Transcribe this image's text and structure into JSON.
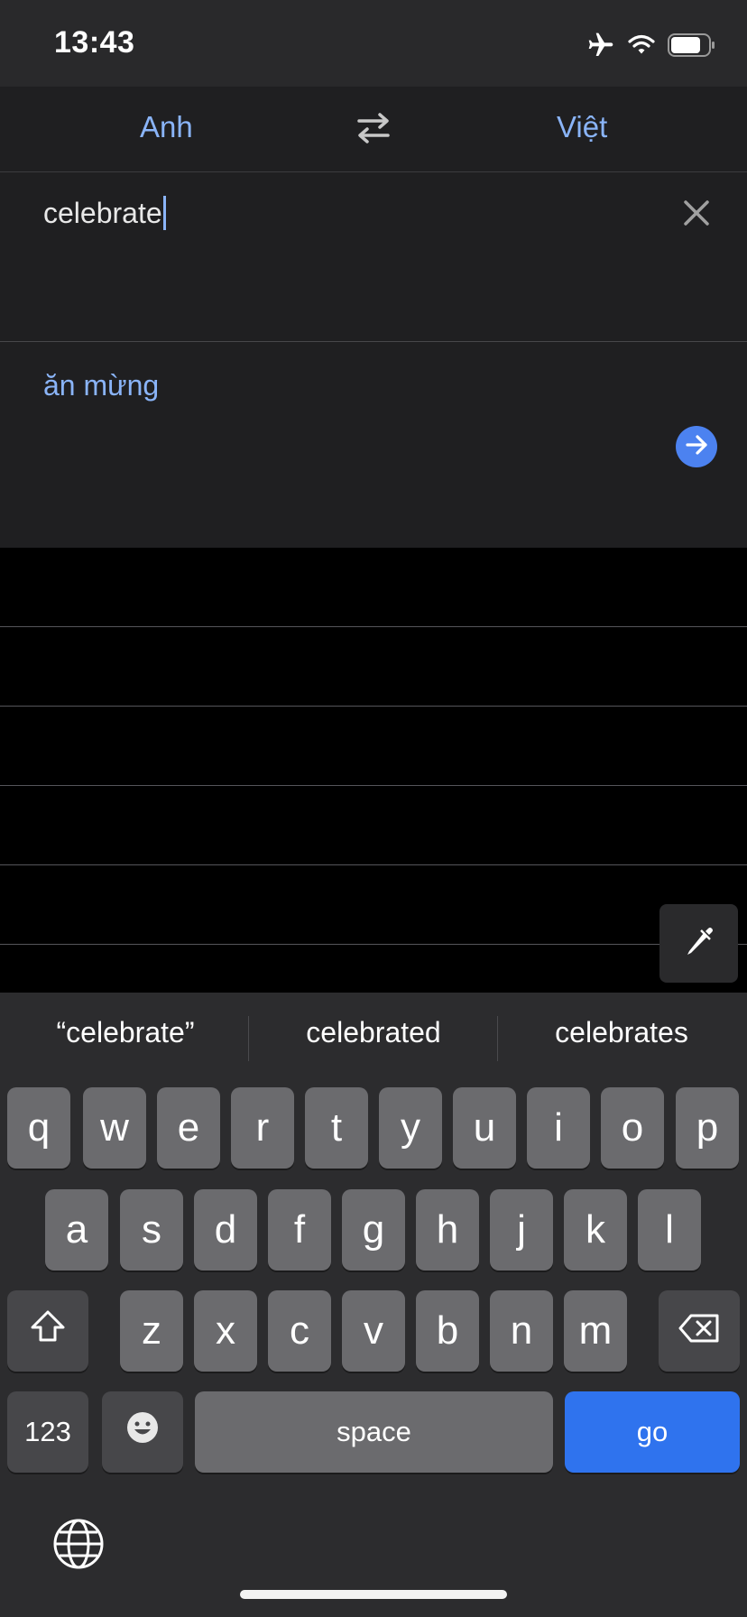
{
  "status_bar": {
    "time": "13:43",
    "icons": [
      "airplane-icon",
      "wifi-icon",
      "battery-icon"
    ]
  },
  "languages": {
    "source": "Anh",
    "target": "Việt",
    "swap_icon": "swap-arrows-icon"
  },
  "input": {
    "text": "celebrate",
    "clear_icon": "close-icon"
  },
  "result": {
    "text": "ăn mừng",
    "action_icon": "arrow-right-icon"
  },
  "handwriting_icon": "pen-icon",
  "keyboard": {
    "suggestions": [
      "“celebrate”",
      "celebrated",
      "celebrates"
    ],
    "row1": [
      "q",
      "w",
      "e",
      "r",
      "t",
      "y",
      "u",
      "i",
      "o",
      "p"
    ],
    "row2": [
      "a",
      "s",
      "d",
      "f",
      "g",
      "h",
      "j",
      "k",
      "l"
    ],
    "row3": [
      "z",
      "x",
      "c",
      "v",
      "b",
      "n",
      "m"
    ],
    "numbers_label": "123",
    "space_label": "space",
    "go_label": "go",
    "emoji_icon": "emoji-icon",
    "globe_icon": "globe-icon",
    "shift_icon": "shift-icon",
    "delete_icon": "backspace-icon"
  },
  "colors": {
    "accent": "#8ab4f8",
    "go_key": "#2f73ee",
    "arrow_button": "#4c82f0"
  }
}
